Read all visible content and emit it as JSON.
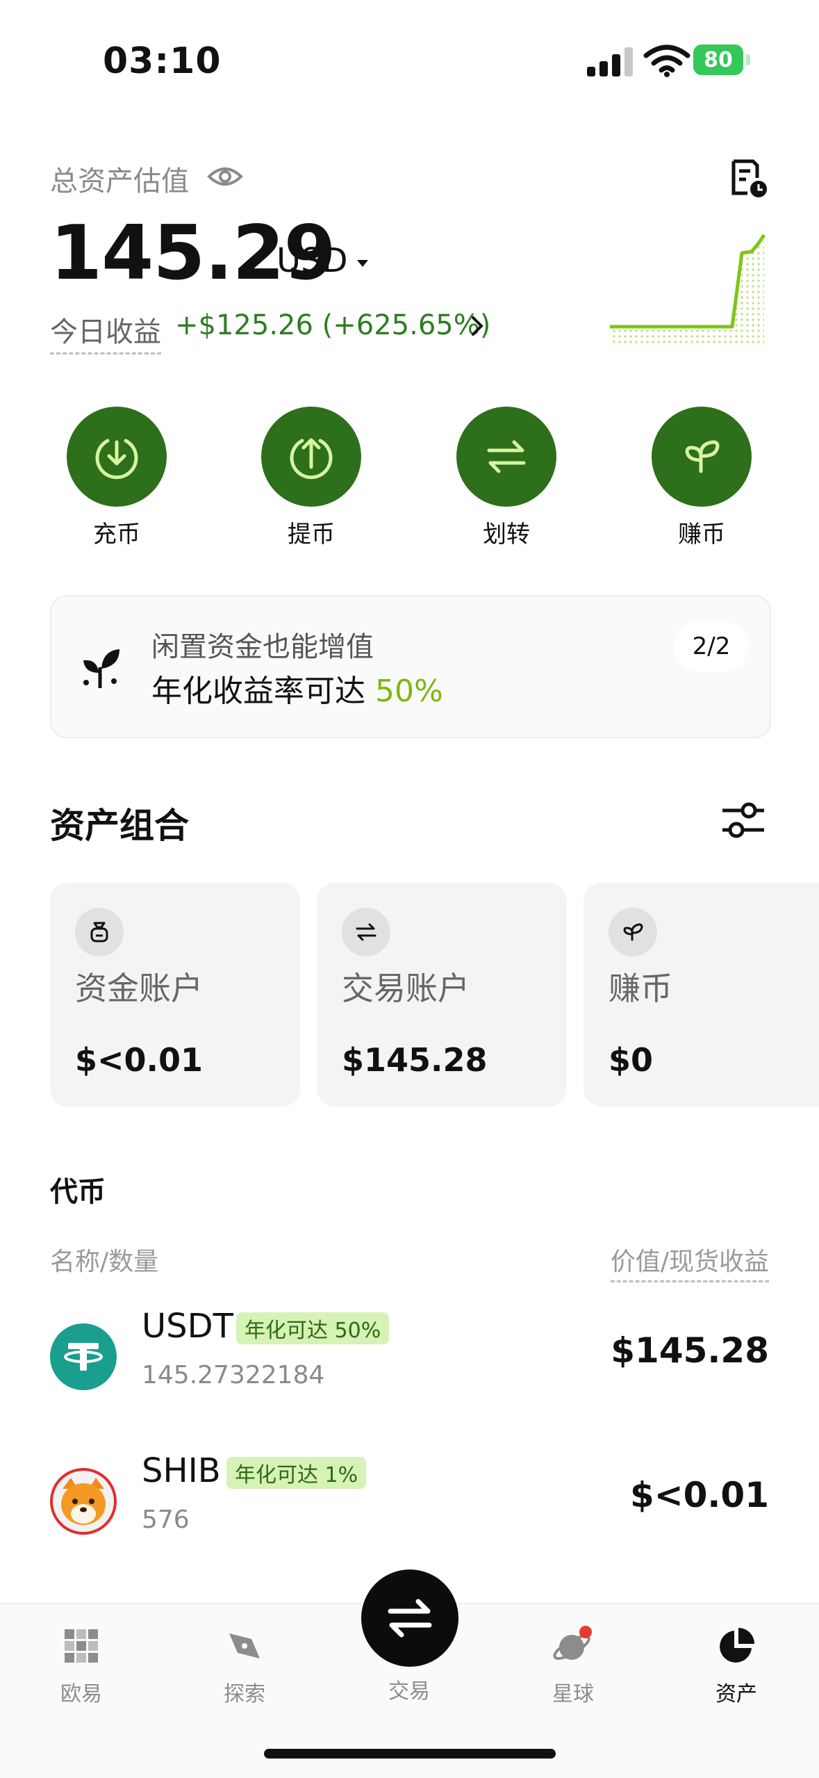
{
  "status": {
    "time": "03:10",
    "battery": "80"
  },
  "header": {
    "total_label": "总资产估值",
    "total_value": "145.29",
    "currency": "USD",
    "pnl_label": "今日收益",
    "pnl_value": "+$125.26 (+625.65%)"
  },
  "actions": [
    {
      "label": "充币",
      "icon": "deposit-icon"
    },
    {
      "label": "提币",
      "icon": "withdraw-icon"
    },
    {
      "label": "划转",
      "icon": "transfer-icon"
    },
    {
      "label": "赚币",
      "icon": "earn-icon"
    }
  ],
  "promo": {
    "title": "闲置资金也能增值",
    "subtitle": "年化收益率可达",
    "highlight": "50%",
    "page": "2/2"
  },
  "portfolio": {
    "title": "资产组合",
    "cards": [
      {
        "name": "资金账户",
        "value": "$<0.01",
        "icon": "wallet-icon"
      },
      {
        "name": "交易账户",
        "value": "$145.28",
        "icon": "swap-icon"
      },
      {
        "name": "赚币",
        "value": "$0",
        "icon": "leaf-icon"
      }
    ]
  },
  "tokens": {
    "title": "代币",
    "col_left": "名称/数量",
    "col_right": "价值/现货收益",
    "items": [
      {
        "symbol": "USDT",
        "badge": "年化可达 50%",
        "qty": "145.27322184",
        "amount": "$145.28"
      },
      {
        "symbol": "SHIB",
        "badge": "年化可达 1%",
        "qty": "576",
        "amount": "$<0.01"
      }
    ]
  },
  "nav": {
    "tabs": [
      {
        "label": "欧易",
        "icon": "okx-logo-icon"
      },
      {
        "label": "探索",
        "icon": "compass-icon"
      },
      {
        "label": "交易",
        "icon": "trade-icon"
      },
      {
        "label": "星球",
        "icon": "planet-icon"
      },
      {
        "label": "资产",
        "icon": "pie-chart-icon"
      }
    ]
  },
  "colors": {
    "accent_green": "#2d6f1a",
    "positive": "#2e7d22",
    "highlight": "#7cb80a"
  }
}
